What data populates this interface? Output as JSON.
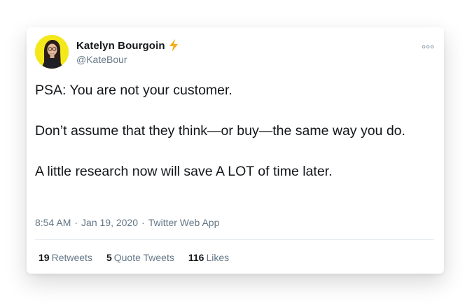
{
  "author": {
    "name": "Katelyn Bourgoin",
    "handle": "@KateBour",
    "badge_icon": "lightning-bolt-icon",
    "badge_color": "#f6ad1c",
    "avatar_bg": "#f4e81a"
  },
  "tweet": {
    "lines": [
      "PSA: You are not your customer.",
      "Don’t assume that they think—or buy—the same way you do.",
      "A little research now will save A LOT of time later."
    ]
  },
  "meta": {
    "time": "8:54 AM",
    "date": "Jan 19, 2020",
    "source": "Twitter Web App",
    "separator": "·"
  },
  "stats": {
    "retweets_count": "19",
    "retweets_label": "Retweets",
    "quotes_count": "5",
    "quotes_label": "Quote Tweets",
    "likes_count": "116",
    "likes_label": "Likes"
  },
  "menu_icon": "more-options-icon",
  "colors": {
    "text": "#14171a",
    "secondary": "#657786",
    "divider": "#e6ecf0"
  }
}
